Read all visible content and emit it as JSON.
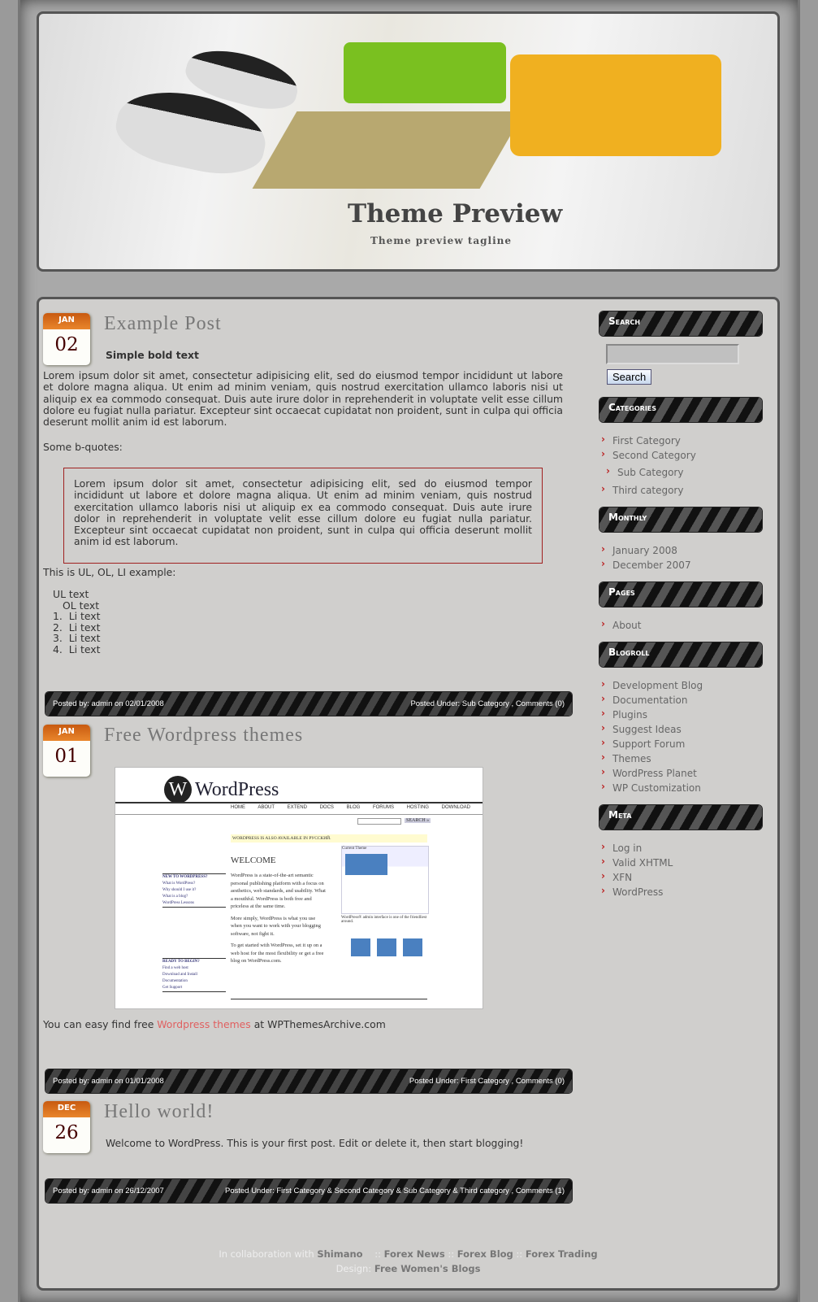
{
  "header": {
    "title": "Theme Preview",
    "tagline": "Theme preview tagline"
  },
  "posts": [
    {
      "month": "JAN",
      "day": "02",
      "title": "Example Post",
      "bold": "Simple bold text",
      "para": "Lorem ipsum dolor sit amet, consectetur adipisicing elit, sed do eiusmod tempor incididunt ut labore et dolore magna aliqua. Ut enim ad minim veniam, quis nostrud exercitation ullamco laboris nisi ut aliquip ex ea commodo consequat. Duis aute irure dolor in reprehenderit in voluptate velit esse cillum dolore eu fugiat nulla pariatur. Excepteur sint occaecat cupidatat non proident, sunt in culpa qui officia deserunt mollit anim id est laborum.",
      "bq_label": "Some b-quotes:",
      "quote": "Lorem ipsum dolor sit amet, consectetur adipisicing elit, sed do eiusmod tempor incididunt ut labore et dolore magna aliqua. Ut enim ad minim veniam, quis nostrud exercitation ullamco laboris nisi ut aliquip ex ea commodo consequat. Duis aute irure dolor in reprehenderit in voluptate velit esse cillum dolore eu fugiat nulla pariatur. Excepteur sint occaecat cupidatat non proident, sunt in culpa qui officia deserunt mollit anim id est laborum.",
      "list_label": "This is UL, OL, LI example:",
      "ul": "UL text",
      "ol": "OL text",
      "li": [
        "Li text",
        "Li text",
        "Li text",
        "Li text"
      ],
      "meta_left": "Posted by: admin on 02/01/2008",
      "meta_right": "Posted Under: Sub Category , Comments (0)"
    },
    {
      "month": "JAN",
      "day": "01",
      "title": "Free Wordpress themes",
      "shot": {
        "logo": "WordPress",
        "nav": [
          "HOME",
          "ABOUT",
          "EXTEND",
          "DOCS",
          "BLOG",
          "FORUMS",
          "HOSTING",
          "DOWNLOAD"
        ],
        "search": "SEARCH »",
        "notice": "WORDPRESS IS ALSO AVAILABLE IN РУССКИЙ.",
        "welcome": "WELCOME",
        "body": "WordPress is a state-of-the-art semantic personal publishing platform with a focus on aesthetics, web standards, and usability. What a mouthful. WordPress is both free and priceless at the same time.",
        "body2": "More simply, WordPress is what you use when you want to work with your blogging software, not fight it.",
        "body3": "To get started with WordPress, set it up on a web host for the most flexibility or get a free blog on WordPress.com.",
        "new": "NEW TO WORDPRESS?",
        "new_items": [
          "What is WordPress?",
          "Why should I use it?",
          "What is a blog?",
          "WordPress Lessons"
        ],
        "ready": "READY TO BEGIN?",
        "ready_items": [
          "Find a web host",
          "Download and Install",
          "Documentation",
          "Get Support"
        ],
        "current": "Current Theme",
        "caption": "WordPress® admin interface is one of the friendliest around."
      },
      "text_before": "You can easy find free ",
      "link": "Wordpress themes",
      "text_after": " at WPThemesArchive.com",
      "meta_left": "Posted by: admin on 01/01/2008",
      "meta_right": "Posted Under: First Category , Comments (0)"
    },
    {
      "month": "DEC",
      "day": "26",
      "title": "Hello world!",
      "para": "Welcome to WordPress. This is your first post. Edit or delete it, then start blogging!",
      "meta_left": "Posted by: admin on 26/12/2007",
      "meta_right": "Posted Under: First Category & Second Category & Sub Category & Third category , Comments (1)"
    }
  ],
  "sidebar": {
    "search": {
      "title": "Search",
      "value": "",
      "button": "Search"
    },
    "categories": {
      "title": "Categories",
      "items": [
        "First Category",
        "Second Category",
        "Sub Category",
        "Third category"
      ]
    },
    "monthly": {
      "title": "Monthly",
      "items": [
        "January 2008",
        "December 2007"
      ]
    },
    "pages": {
      "title": "Pages",
      "items": [
        "About"
      ]
    },
    "blogroll": {
      "title": "Blogroll",
      "items": [
        "Development Blog",
        "Documentation",
        "Plugins",
        "Suggest Ideas",
        "Support Forum",
        "Themes",
        "WordPress Planet",
        "WP Customization"
      ]
    },
    "meta": {
      "title": "Meta",
      "items": [
        "Log in",
        "Valid XHTML",
        "XFN",
        "WordPress"
      ]
    }
  },
  "footer": {
    "collab": "In collaboration with ",
    "shimano": "Shimano",
    "sep": " :: ",
    "links": [
      "Forex News",
      "Forex Blog",
      "Forex Trading"
    ],
    "design": "Design: ",
    "design_link": "Free Women's Blogs"
  },
  "colors": {
    "link": "#e06060",
    "date_header": "#d96f1c",
    "quote_border": "#a02020"
  }
}
